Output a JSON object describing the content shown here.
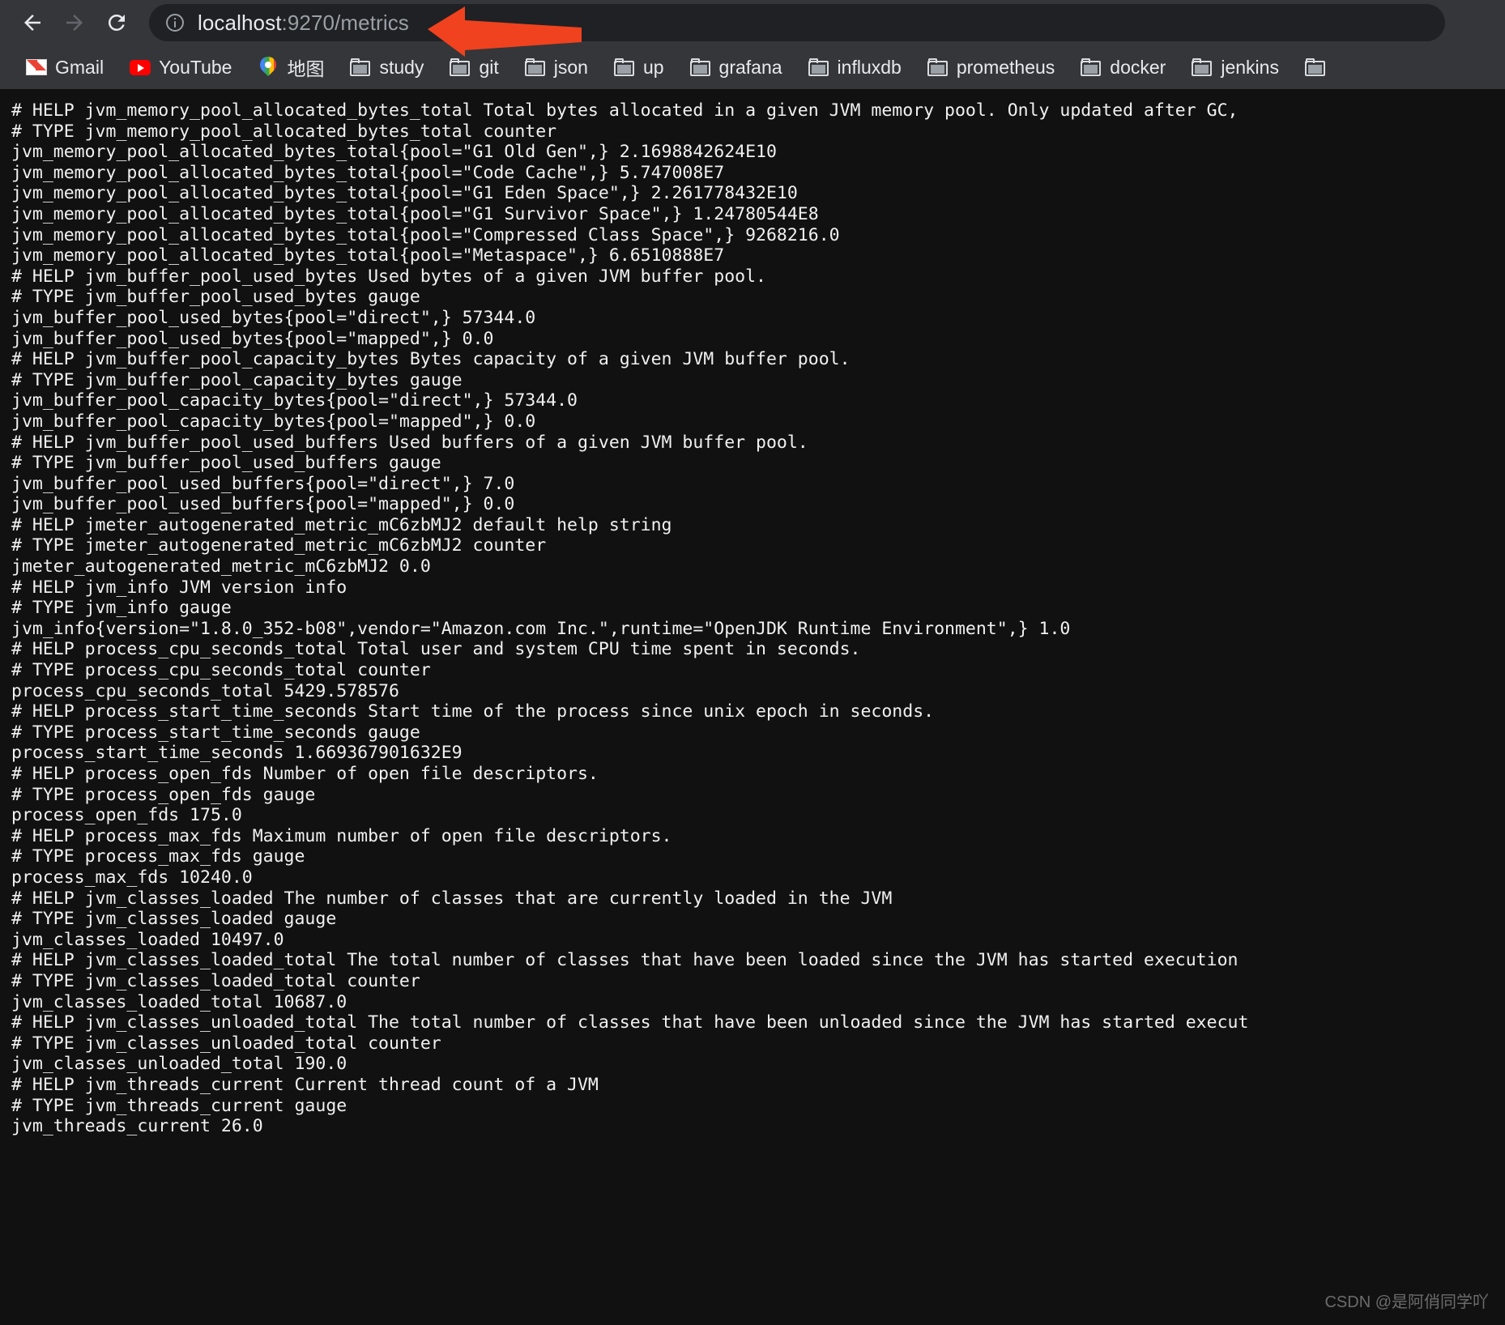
{
  "browser": {
    "back_icon": "arrow-left-icon",
    "forward_icon": "arrow-right-icon",
    "reload_icon": "reload-icon",
    "omnibox": {
      "info_icon": "info-circle-icon",
      "url_host": "localhost",
      "url_path": ":9270/metrics",
      "full_url": "localhost:9270/metrics"
    },
    "annotation": {
      "type": "red-arrow",
      "color": "#f04020",
      "points_to": "omnibox-url"
    },
    "bookmarks": [
      {
        "label": "Gmail",
        "icon": "gmail-icon"
      },
      {
        "label": "YouTube",
        "icon": "youtube-icon"
      },
      {
        "label": "地图",
        "icon": "google-maps-icon"
      },
      {
        "label": "study",
        "icon": "folder-icon"
      },
      {
        "label": "git",
        "icon": "folder-icon"
      },
      {
        "label": "json",
        "icon": "folder-icon"
      },
      {
        "label": "up",
        "icon": "folder-icon"
      },
      {
        "label": "grafana",
        "icon": "folder-icon"
      },
      {
        "label": "influxdb",
        "icon": "folder-icon"
      },
      {
        "label": "prometheus",
        "icon": "folder-icon"
      },
      {
        "label": "docker",
        "icon": "folder-icon"
      },
      {
        "label": "jenkins",
        "icon": "folder-icon"
      },
      {
        "label": "",
        "icon": "folder-icon"
      }
    ]
  },
  "content": {
    "body_text": "# HELP jvm_memory_pool_allocated_bytes_total Total bytes allocated in a given JVM memory pool. Only updated after GC,\n# TYPE jvm_memory_pool_allocated_bytes_total counter\njvm_memory_pool_allocated_bytes_total{pool=\"G1 Old Gen\",} 2.1698842624E10\njvm_memory_pool_allocated_bytes_total{pool=\"Code Cache\",} 5.747008E7\njvm_memory_pool_allocated_bytes_total{pool=\"G1 Eden Space\",} 2.261778432E10\njvm_memory_pool_allocated_bytes_total{pool=\"G1 Survivor Space\",} 1.24780544E8\njvm_memory_pool_allocated_bytes_total{pool=\"Compressed Class Space\",} 9268216.0\njvm_memory_pool_allocated_bytes_total{pool=\"Metaspace\",} 6.6510888E7\n# HELP jvm_buffer_pool_used_bytes Used bytes of a given JVM buffer pool.\n# TYPE jvm_buffer_pool_used_bytes gauge\njvm_buffer_pool_used_bytes{pool=\"direct\",} 57344.0\njvm_buffer_pool_used_bytes{pool=\"mapped\",} 0.0\n# HELP jvm_buffer_pool_capacity_bytes Bytes capacity of a given JVM buffer pool.\n# TYPE jvm_buffer_pool_capacity_bytes gauge\njvm_buffer_pool_capacity_bytes{pool=\"direct\",} 57344.0\njvm_buffer_pool_capacity_bytes{pool=\"mapped\",} 0.0\n# HELP jvm_buffer_pool_used_buffers Used buffers of a given JVM buffer pool.\n# TYPE jvm_buffer_pool_used_buffers gauge\njvm_buffer_pool_used_buffers{pool=\"direct\",} 7.0\njvm_buffer_pool_used_buffers{pool=\"mapped\",} 0.0\n# HELP jmeter_autogenerated_metric_mC6zbMJ2 default help string\n# TYPE jmeter_autogenerated_metric_mC6zbMJ2 counter\njmeter_autogenerated_metric_mC6zbMJ2 0.0\n# HELP jvm_info JVM version info\n# TYPE jvm_info gauge\njvm_info{version=\"1.8.0_352-b08\",vendor=\"Amazon.com Inc.\",runtime=\"OpenJDK Runtime Environment\",} 1.0\n# HELP process_cpu_seconds_total Total user and system CPU time spent in seconds.\n# TYPE process_cpu_seconds_total counter\nprocess_cpu_seconds_total 5429.578576\n# HELP process_start_time_seconds Start time of the process since unix epoch in seconds.\n# TYPE process_start_time_seconds gauge\nprocess_start_time_seconds 1.669367901632E9\n# HELP process_open_fds Number of open file descriptors.\n# TYPE process_open_fds gauge\nprocess_open_fds 175.0\n# HELP process_max_fds Maximum number of open file descriptors.\n# TYPE process_max_fds gauge\nprocess_max_fds 10240.0\n# HELP jvm_classes_loaded The number of classes that are currently loaded in the JVM\n# TYPE jvm_classes_loaded gauge\njvm_classes_loaded 10497.0\n# HELP jvm_classes_loaded_total The total number of classes that have been loaded since the JVM has started execution\n# TYPE jvm_classes_loaded_total counter\njvm_classes_loaded_total 10687.0\n# HELP jvm_classes_unloaded_total The total number of classes that have been unloaded since the JVM has started execut\n# TYPE jvm_classes_unloaded_total counter\njvm_classes_unloaded_total 190.0\n# HELP jvm_threads_current Current thread count of a JVM\n# TYPE jvm_threads_current gauge\njvm_threads_current 26.0"
  },
  "watermark": {
    "text": "CSDN @是阿俏同学吖"
  }
}
